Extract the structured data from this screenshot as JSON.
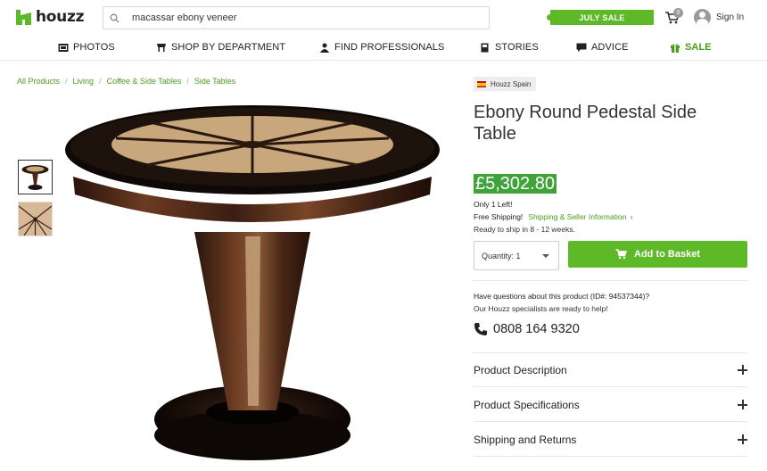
{
  "header": {
    "logo_text": "houzz",
    "search_value": "macassar ebony veneer",
    "sale_banner": "JULY SALE",
    "cart_count": "0",
    "signin_label": "Sign In"
  },
  "nav": {
    "items": [
      {
        "label": "PHOTOS",
        "icon": "photos-icon"
      },
      {
        "label": "SHOP BY DEPARTMENT",
        "icon": "shop-icon"
      },
      {
        "label": "FIND PROFESSIONALS",
        "icon": "professionals-icon"
      },
      {
        "label": "STORIES",
        "icon": "stories-icon"
      },
      {
        "label": "ADVICE",
        "icon": "advice-icon"
      },
      {
        "label": "SALE",
        "icon": "gift-icon"
      }
    ]
  },
  "breadcrumb": [
    "All Products",
    "Living",
    "Coffee & Side Tables",
    "Side Tables"
  ],
  "product": {
    "seller": "Houzz Spain",
    "title": "Ebony Round Pedestal Side Table",
    "price": "£5,302.80",
    "stock": "Only 1 Left!",
    "shipping_label": "Free Shipping!",
    "shipping_link": "Shipping & Seller Information",
    "ready": "Ready to ship in 8 - 12 weeks.",
    "quantity_label": "Quantity: 1",
    "basket_label": "Add to Basket",
    "questions": "Have questions about this product (ID#: 94537344)?",
    "specialists": "Our Houzz specialists are ready to help!",
    "phone": "0808 164 9320"
  },
  "accordion": [
    {
      "label": "Product Description"
    },
    {
      "label": "Product Specifications"
    },
    {
      "label": "Shipping and Returns"
    }
  ],
  "colors": {
    "brand_green": "#5eb928",
    "price_bg": "#3fa33a",
    "link_green": "#4a9d1e"
  }
}
